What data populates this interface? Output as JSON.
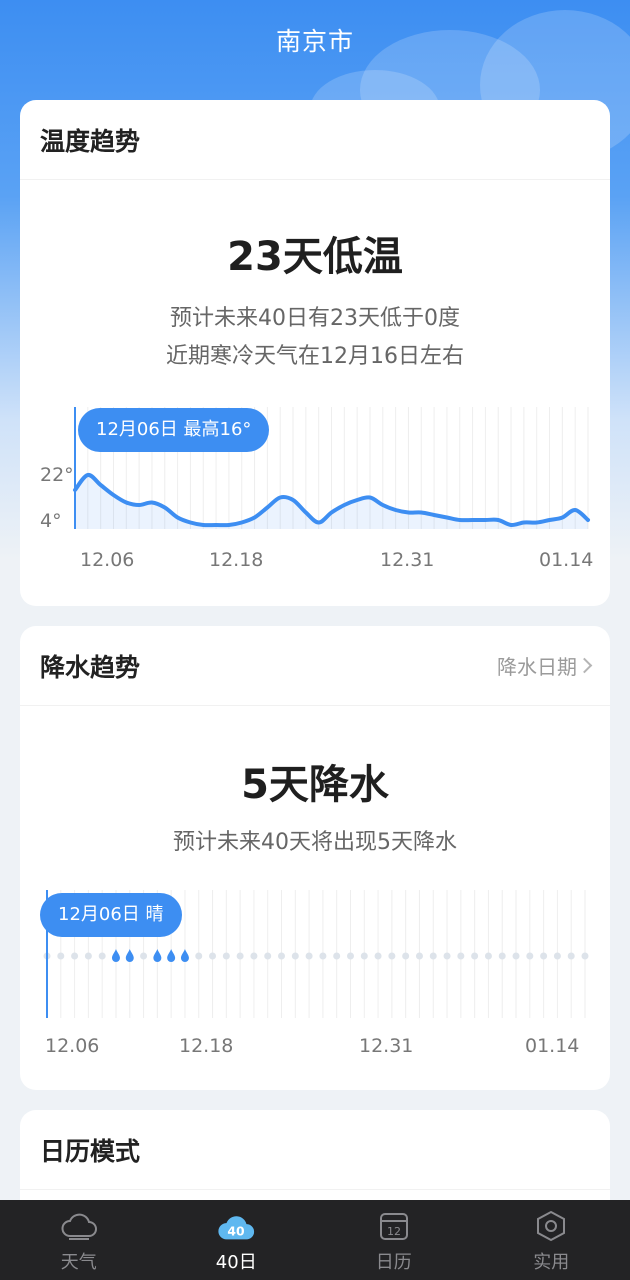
{
  "header": {
    "title": "南京市"
  },
  "temperature": {
    "title": "温度趋势",
    "stat": "23天低温",
    "desc_line1": "预计未来40日有23天低于0度",
    "desc_line2": "近期寒冷天气在12月16日左右",
    "tooltip": "12月06日 最高16°",
    "y_labels": [
      "22°",
      "4°"
    ],
    "x_labels": [
      "12.06",
      "12.18",
      "12.31",
      "01.14"
    ]
  },
  "precipitation": {
    "title": "降水趋势",
    "link": "降水日期",
    "stat": "5天降水",
    "desc": "预计未来40天将出现5天降水",
    "tooltip": "12月06日 晴",
    "x_labels": [
      "12.06",
      "12.18",
      "12.31",
      "01.14"
    ]
  },
  "calendar": {
    "title": "日历模式"
  },
  "tabs": [
    {
      "label": "天气",
      "icon": "cloud-icon",
      "active": false
    },
    {
      "label": "40日",
      "icon": "forty-day-icon",
      "active": true
    },
    {
      "label": "日历",
      "icon": "calendar-icon",
      "active": false
    },
    {
      "label": "实用",
      "icon": "hexagon-gear-icon",
      "active": false
    }
  ],
  "chart_data": [
    {
      "type": "line",
      "title": "温度趋势",
      "x_tick_labels": [
        "12.06",
        "12.18",
        "12.31",
        "01.14"
      ],
      "y_tick_labels": [
        "22°",
        "4°"
      ],
      "series": [
        {
          "values": [
            16,
            22,
            18,
            14,
            11,
            10,
            11,
            9,
            5,
            3,
            2,
            2,
            2,
            3,
            5,
            9,
            13,
            12,
            7,
            3,
            7,
            10,
            12,
            13,
            10,
            8,
            7,
            7,
            6,
            5,
            4,
            4,
            4,
            4,
            2,
            3,
            3,
            4,
            5,
            8,
            4
          ]
        }
      ]
    },
    {
      "type": "scatter",
      "title": "降水趋势",
      "x_tick_labels": [
        "12.06",
        "12.18",
        "12.31",
        "01.14"
      ],
      "rain_days": [
        5,
        6,
        8,
        9,
        10
      ],
      "days": 40
    }
  ]
}
